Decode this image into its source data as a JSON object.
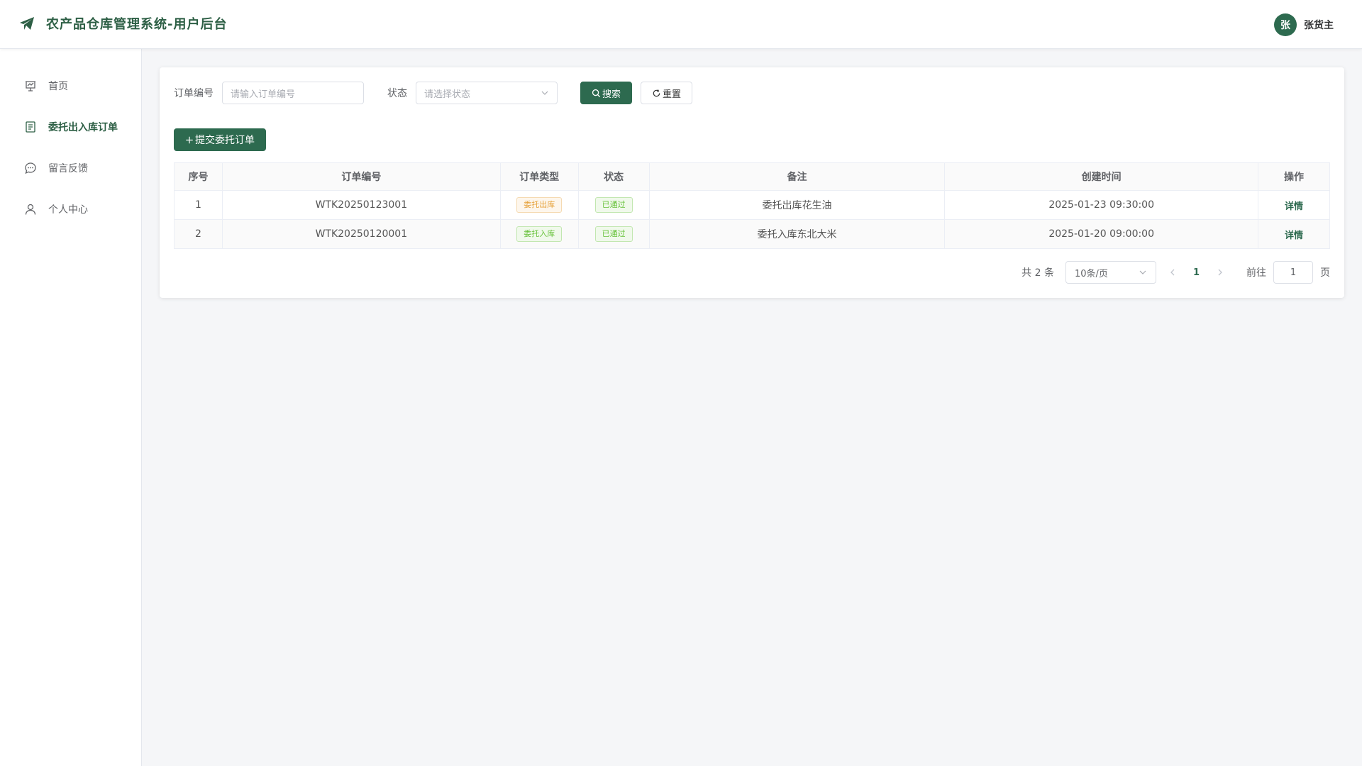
{
  "header": {
    "title": "农产品仓库管理系统-用户后台",
    "brand_icon": "paper-plane-icon",
    "user": {
      "avatar_text": "张",
      "name": "张货主"
    }
  },
  "sidebar": {
    "items": [
      {
        "label": "首页",
        "icon": "home-icon",
        "active": false
      },
      {
        "label": "委托出入库订单",
        "icon": "document-icon",
        "active": true
      },
      {
        "label": "留言反馈",
        "icon": "chat-icon",
        "active": false
      },
      {
        "label": "个人中心",
        "icon": "user-icon",
        "active": false
      }
    ]
  },
  "filters": {
    "order_label": "订单编号",
    "order_placeholder": "请输入订单编号",
    "status_label": "状态",
    "status_placeholder": "请选择状态",
    "search_button": "搜索",
    "reset_button": "重置"
  },
  "actions": {
    "add_button": "提交委托订单"
  },
  "table": {
    "headers": [
      "序号",
      "订单编号",
      "订单类型",
      "状态",
      "备注",
      "创建时间",
      "操作"
    ],
    "rows": [
      {
        "index": "1",
        "order_no": "WTK20250123001",
        "type": "委托出库",
        "status": "已通过",
        "remark": "委托出库花生油",
        "created": "2025-01-23 09:30:00",
        "action": "详情"
      },
      {
        "index": "2",
        "order_no": "WTK20250120001",
        "type": "委托入库",
        "status": "已通过",
        "remark": "委托入库东北大米",
        "created": "2025-01-20 09:00:00",
        "action": "详情"
      }
    ]
  },
  "pagination": {
    "total_text": "共 2 条",
    "page_size": "10条/页",
    "current_page": "1",
    "jump_label": "前往",
    "jump_value": "1",
    "page_suffix": "页"
  },
  "colors": {
    "brand": "#2d6a4f",
    "brand_text": "#2d5f45",
    "tag_out": "#e6a23c",
    "tag_in": "#67c23a"
  }
}
